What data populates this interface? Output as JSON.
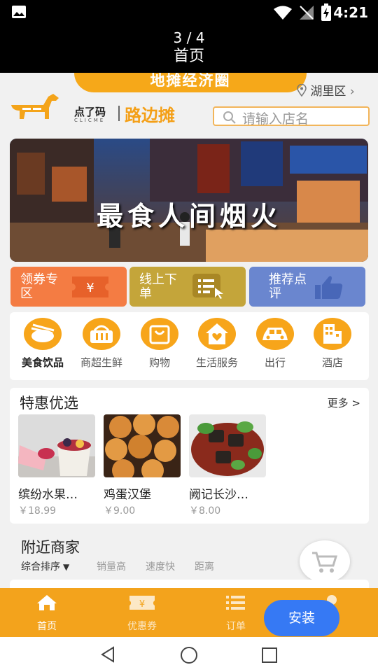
{
  "status_bar": {
    "time": "4:21"
  },
  "viewer": {
    "counter": "3 / 4",
    "title": "首页"
  },
  "header": {
    "pill_text": "地摊经济圈",
    "location": "湖里区",
    "brand_cn": "点了码",
    "brand_en": "CLICME",
    "brand_name": "路边摊",
    "search_placeholder": "请输入店名"
  },
  "banner": {
    "text": "最食人间烟火"
  },
  "quick_buttons": [
    {
      "label": "领券专区",
      "color": "#f47c43"
    },
    {
      "label": "线上下单",
      "color": "#c4a53a"
    },
    {
      "label": "推荐点评",
      "color": "#6a86cf"
    }
  ],
  "categories": [
    {
      "label": "美食饮品",
      "icon": "bowl-icon"
    },
    {
      "label": "商超生鲜",
      "icon": "basket-icon"
    },
    {
      "label": "购物",
      "icon": "shopping-bag-icon"
    },
    {
      "label": "生活服务",
      "icon": "house-heart-icon"
    },
    {
      "label": "出行",
      "icon": "car-icon"
    },
    {
      "label": "酒店",
      "icon": "hotel-icon"
    }
  ],
  "deals": {
    "title": "特惠优选",
    "more": "更多 >",
    "items": [
      {
        "name": "缤纷水果…",
        "price": "￥18.99"
      },
      {
        "name": "鸡蛋汉堡",
        "price": "￥9.00"
      },
      {
        "name": "阙记长沙…",
        "price": "￥8.00"
      }
    ]
  },
  "nearby": {
    "title": "附近商家",
    "sorts": [
      "综合排序",
      "销量高",
      "速度快",
      "距离"
    ]
  },
  "tabbar": {
    "tabs": [
      {
        "label": "首页"
      },
      {
        "label": "优惠券"
      },
      {
        "label": "订单"
      }
    ]
  },
  "install_label": "安装",
  "colors": {
    "accent": "#f3a31c",
    "install": "#3679f4",
    "blue_tile": "#6a86cf"
  }
}
